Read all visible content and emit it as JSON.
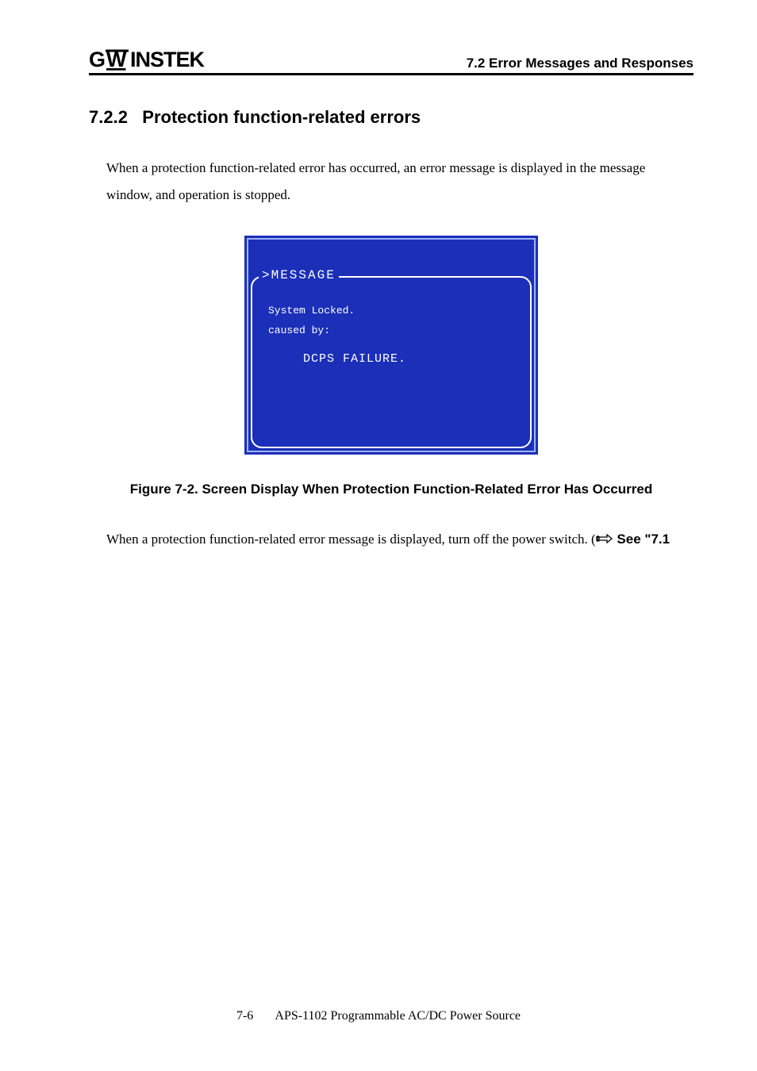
{
  "header": {
    "logo_text": "GWINSTEK",
    "right": "7.2 Error Messages and Responses"
  },
  "section": {
    "number": "7.2.2",
    "title": "Protection function-related errors"
  },
  "intro": "When a protection function-related error has occurred, an error message is displayed in the message window, and operation is stopped.",
  "screen": {
    "title": ">MESSAGE",
    "line1": "System Locked.",
    "line2": "caused by:",
    "line3": "DCPS FAILURE."
  },
  "figure_caption": "Figure 7-2.  Screen Display When Protection Function-Related Error Has Occurred",
  "ref_text_before": "When a protection function-related error message is displayed, turn off the power switch.  (",
  "ref_see": " See \"7.1",
  "footer": {
    "page": "7-6",
    "doc": "APS-1102 Programmable AC/DC Power Source"
  }
}
